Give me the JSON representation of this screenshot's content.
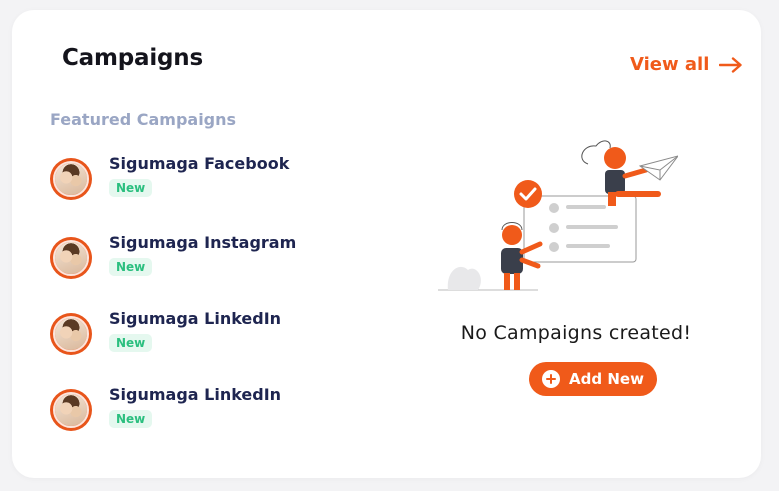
{
  "header": {
    "title": "Campaigns",
    "view_all_label": "View all"
  },
  "featured": {
    "section_label": "Featured Campaigns",
    "items": [
      {
        "name": "Sigumaga Facebook",
        "badge": "New"
      },
      {
        "name": "Sigumaga Instagram",
        "badge": "New"
      },
      {
        "name": "Sigumaga LinkedIn",
        "badge": "New"
      },
      {
        "name": "Sigumaga LinkedIn",
        "badge": "New"
      }
    ]
  },
  "empty_state": {
    "message": "No Campaigns created!",
    "add_button_label": "Add New"
  },
  "colors": {
    "accent": "#f05a1a",
    "badge_bg": "#e5f8ef",
    "badge_text": "#2bbf7f",
    "section_label": "#9aa6c4",
    "item_text": "#1e2550"
  },
  "icons": {
    "view_all": "arrow-right-icon",
    "add": "plus-circle-icon",
    "illustration": "empty-campaigns-illustration"
  }
}
